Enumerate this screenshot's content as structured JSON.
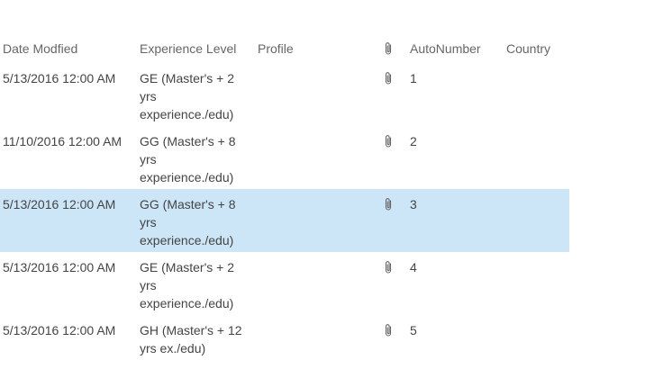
{
  "columns": {
    "date_modified": "Date Modfied",
    "experience_level": "Experience Level",
    "profile": "Profile",
    "attachment_icon": "paperclip-icon",
    "autonumber": "AutoNumber",
    "country": "Country"
  },
  "rows": [
    {
      "date_modified": "5/13/2016 12:00 AM",
      "experience_level": "GE (Master's + 2 yrs experience./edu)",
      "profile": "",
      "autonumber": "1",
      "country": "",
      "selected": false
    },
    {
      "date_modified": "11/10/2016 12:00 AM",
      "experience_level": "GG (Master's + 8 yrs experience./edu)",
      "profile": "",
      "autonumber": "2",
      "country": "",
      "selected": false
    },
    {
      "date_modified": "5/13/2016 12:00 AM",
      "experience_level": "GG (Master's + 8 yrs experience./edu)",
      "profile": "",
      "autonumber": "3",
      "country": "",
      "selected": true
    },
    {
      "date_modified": "5/13/2016 12:00 AM",
      "experience_level": "GE (Master's + 2 yrs experience./edu)",
      "profile": "",
      "autonumber": "4",
      "country": "",
      "selected": false
    },
    {
      "date_modified": "5/13/2016 12:00 AM",
      "experience_level": "GH (Master's + 12 yrs ex./edu)",
      "profile": "",
      "autonumber": "5",
      "country": "",
      "selected": false
    }
  ],
  "colors": {
    "selected_row": "#cde6f7",
    "text": "#444444",
    "header_text": "#666666"
  }
}
